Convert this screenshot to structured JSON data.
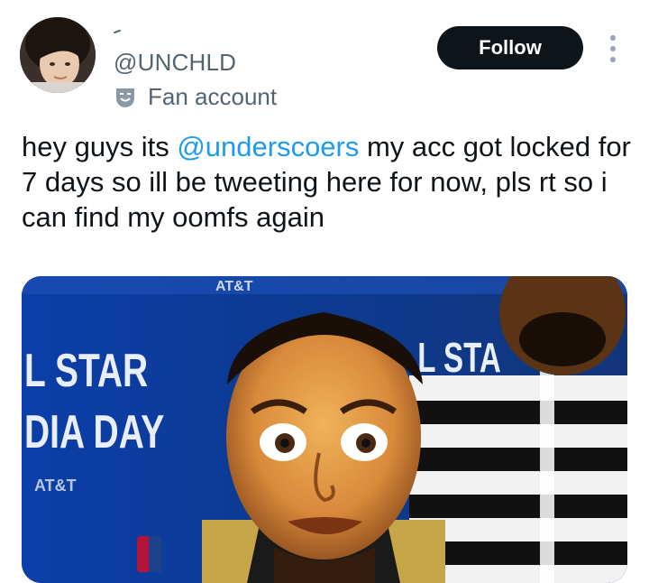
{
  "tweet": {
    "handle": "@UNCHLD",
    "badge_label": "Fan account",
    "follow_label": "Follow",
    "text_before": "hey guys its ",
    "mention": "@underscoers",
    "text_after": " my acc got locked for 7 days so ill be tweeting here for now, pls rt so i can find my oomfs again"
  },
  "media": {
    "backdrop_left_line1": "L STAR",
    "backdrop_left_line2": "DIA DAY",
    "backdrop_sponsor": "AT&T",
    "backdrop_top": "AT&T",
    "backdrop_right": "L STA"
  },
  "colors": {
    "mention": "#1d9bf0",
    "follow_bg": "#0f1419",
    "secondary_text": "#536471",
    "backdrop_blue": "#0d3a8f"
  },
  "icons": [
    "avatar-photo",
    "fan-account-mask-icon",
    "more-options-icon"
  ]
}
